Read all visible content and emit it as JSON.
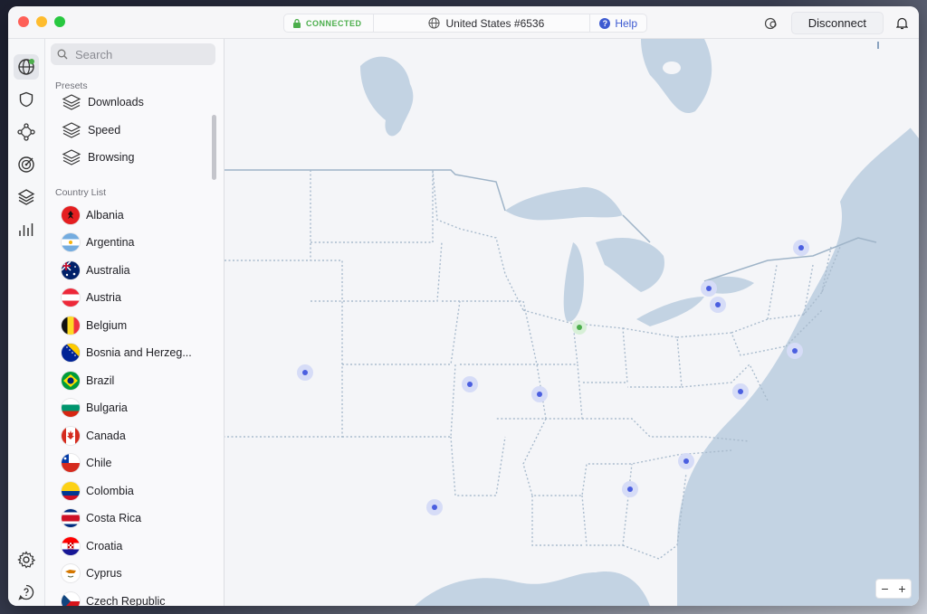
{
  "titlebar": {
    "status": "CONNECTED",
    "server": "United States #6536",
    "help": "Help",
    "disconnect": "Disconnect"
  },
  "sidebar": {
    "search_placeholder": "Search",
    "presets_title": "Presets",
    "presets": [
      {
        "label": "Downloads"
      },
      {
        "label": "Speed"
      },
      {
        "label": "Browsing"
      }
    ],
    "country_title": "Country List",
    "countries": [
      {
        "label": "Albania"
      },
      {
        "label": "Argentina"
      },
      {
        "label": "Australia"
      },
      {
        "label": "Austria"
      },
      {
        "label": "Belgium"
      },
      {
        "label": "Bosnia and Herzeg..."
      },
      {
        "label": "Brazil"
      },
      {
        "label": "Bulgaria"
      },
      {
        "label": "Canada"
      },
      {
        "label": "Chile"
      },
      {
        "label": "Colombia"
      },
      {
        "label": "Costa Rica"
      },
      {
        "label": "Croatia"
      },
      {
        "label": "Cyprus"
      },
      {
        "label": "Czech Republic"
      }
    ]
  },
  "map": {
    "zoom_out": "−",
    "zoom_in": "+"
  },
  "colors": {
    "connected": "#4cae4c",
    "accent": "#3d5ad1",
    "water": "#c3d3e3",
    "land": "#f4f5f8",
    "server_dot": "#4b5fe0"
  }
}
